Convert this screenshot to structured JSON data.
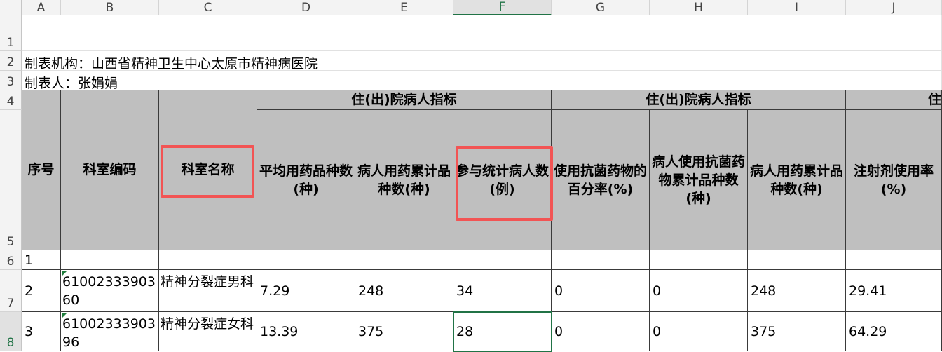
{
  "columns": [
    "A",
    "B",
    "C",
    "D",
    "E",
    "F",
    "G",
    "H",
    "I",
    "J"
  ],
  "rows": [
    "1",
    "2",
    "3",
    "4",
    "5",
    "6",
    "7",
    "8"
  ],
  "sheet": {
    "org_line": "制表机构：山西省精神卫生中心太原市精神病医院",
    "maker_line": "制表人：张娟娟",
    "group_header_1": "住(出)院病人指标",
    "group_header_2": "住(出)院病人指标",
    "group_header_3": "住",
    "headers": {
      "a": "序号",
      "b": "科室编码",
      "c": "科室名称",
      "d": "平均用药品种数(种)",
      "e": "病人用药累计品种数(种)",
      "f": "参与统计病人数(例)",
      "g": "使用抗菌药物的百分率(%)",
      "h": "病人使用抗菌药物累计品种数(种)",
      "i": "病人用药累计品种数(种)",
      "j": "注射剂使用率(%)"
    },
    "data_rows": [
      {
        "a": "1",
        "b": "",
        "c": "",
        "d": "",
        "e": "",
        "f": "",
        "g": "",
        "h": "",
        "i": "",
        "j": ""
      },
      {
        "a": "2",
        "b": "6100233390360",
        "c": "精神分裂症男科",
        "d": "7.29",
        "e": "248",
        "f": "34",
        "g": "0",
        "h": "0",
        "i": "248",
        "j": "29.41"
      },
      {
        "a": "3",
        "b": "6100233390396",
        "c": "精神分裂症女科",
        "d": "13.39",
        "e": "375",
        "f": "28",
        "g": "0",
        "h": "0",
        "i": "375",
        "j": "64.29"
      }
    ]
  },
  "colors": {
    "header_fill": "#bfbfbf",
    "highlight": "#f25454",
    "selection": "#217346"
  }
}
